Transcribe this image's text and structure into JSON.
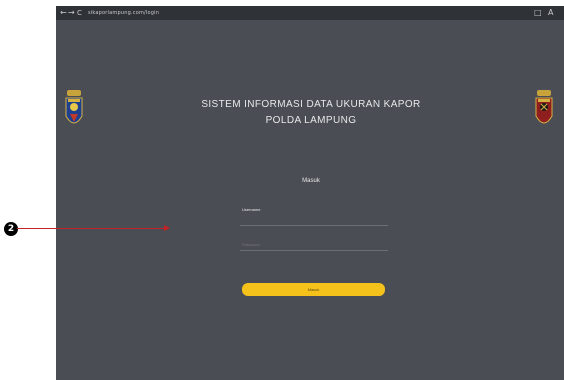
{
  "browser": {
    "back_icon": "←",
    "forward_icon": "→",
    "reload_icon": "C",
    "url": "sikaporlampung.com/login",
    "extension_icon": "□",
    "profile_icon": "A"
  },
  "header": {
    "title_line1": "SISTEM INFORMASI DATA UKURAN KAPOR",
    "title_line2": "POLDA LAMPUNG",
    "left_emblem": "polda-lampung-emblem",
    "right_emblem": "police-emblem"
  },
  "form": {
    "heading": "Masuk",
    "username_label": "Username",
    "username_placeholder": "",
    "password_placeholder": "Password",
    "submit_label": "Masuk"
  },
  "annotation": {
    "number": "2",
    "color": "#c42326"
  },
  "colors": {
    "page_bg": "#4a4d53",
    "button": "#f4c21b",
    "browser_bar": "#2f3237"
  }
}
